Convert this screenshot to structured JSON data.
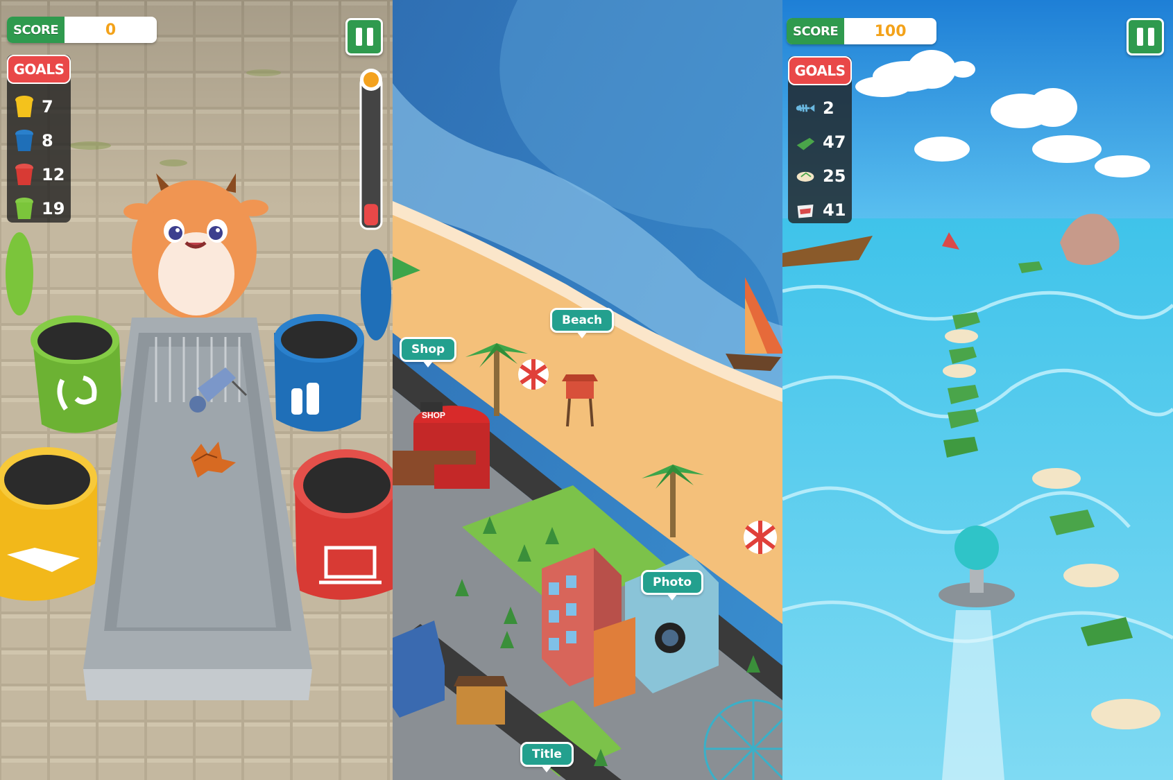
{
  "panel1": {
    "score_label": "SCORE",
    "score_value": "0",
    "goals_label": "GOALS",
    "goals": [
      {
        "icon": "yellow-bin-icon",
        "color": "#f4c21c",
        "count": "7"
      },
      {
        "icon": "blue-bin-icon",
        "color": "#1f6fb8",
        "count": "8"
      },
      {
        "icon": "red-bin-icon",
        "color": "#d83a34",
        "count": "12"
      },
      {
        "icon": "green-bin-icon",
        "color": "#7bc53b",
        "count": "19"
      }
    ],
    "timer_level": 0.15
  },
  "panel2": {
    "bubbles": {
      "shop": "Shop",
      "beach": "Beach",
      "photo": "Photo",
      "title": "Title"
    },
    "sign_text": "SHOP"
  },
  "panel3": {
    "score_label": "SCORE",
    "score_value": "100",
    "goals_label": "GOALS",
    "goals": [
      {
        "icon": "fish-bone-icon",
        "count": "2"
      },
      {
        "icon": "plastic-bag-icon",
        "count": "47"
      },
      {
        "icon": "flip-flop-icon",
        "count": "25"
      },
      {
        "icon": "chip-bag-icon",
        "count": "41"
      }
    ]
  }
}
